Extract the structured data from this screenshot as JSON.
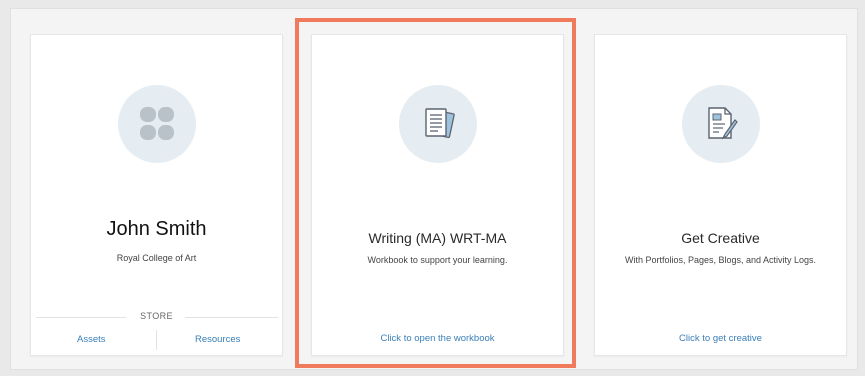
{
  "profile_card": {
    "name": "John Smith",
    "institution": "Royal College of Art",
    "store_label": "STORE",
    "assets_label": "Assets",
    "resources_label": "Resources"
  },
  "workbook_card": {
    "title": "Writing (MA) WRT-MA",
    "description": "Workbook to support your learning.",
    "link_label": "Click to open the workbook"
  },
  "creative_card": {
    "title": "Get Creative",
    "description": "With Portfolios, Pages, Blogs, and Activity Logs.",
    "link_label": "Click to get creative"
  },
  "colors": {
    "accent_link": "#3a7fb8",
    "highlight_border": "#f07a5c",
    "icon_circle_bg": "#e5edf2"
  },
  "icons": {
    "profile": "four-petal-avatar-icon",
    "workbook": "workbook-pages-icon",
    "creative": "document-with-brush-icon"
  }
}
